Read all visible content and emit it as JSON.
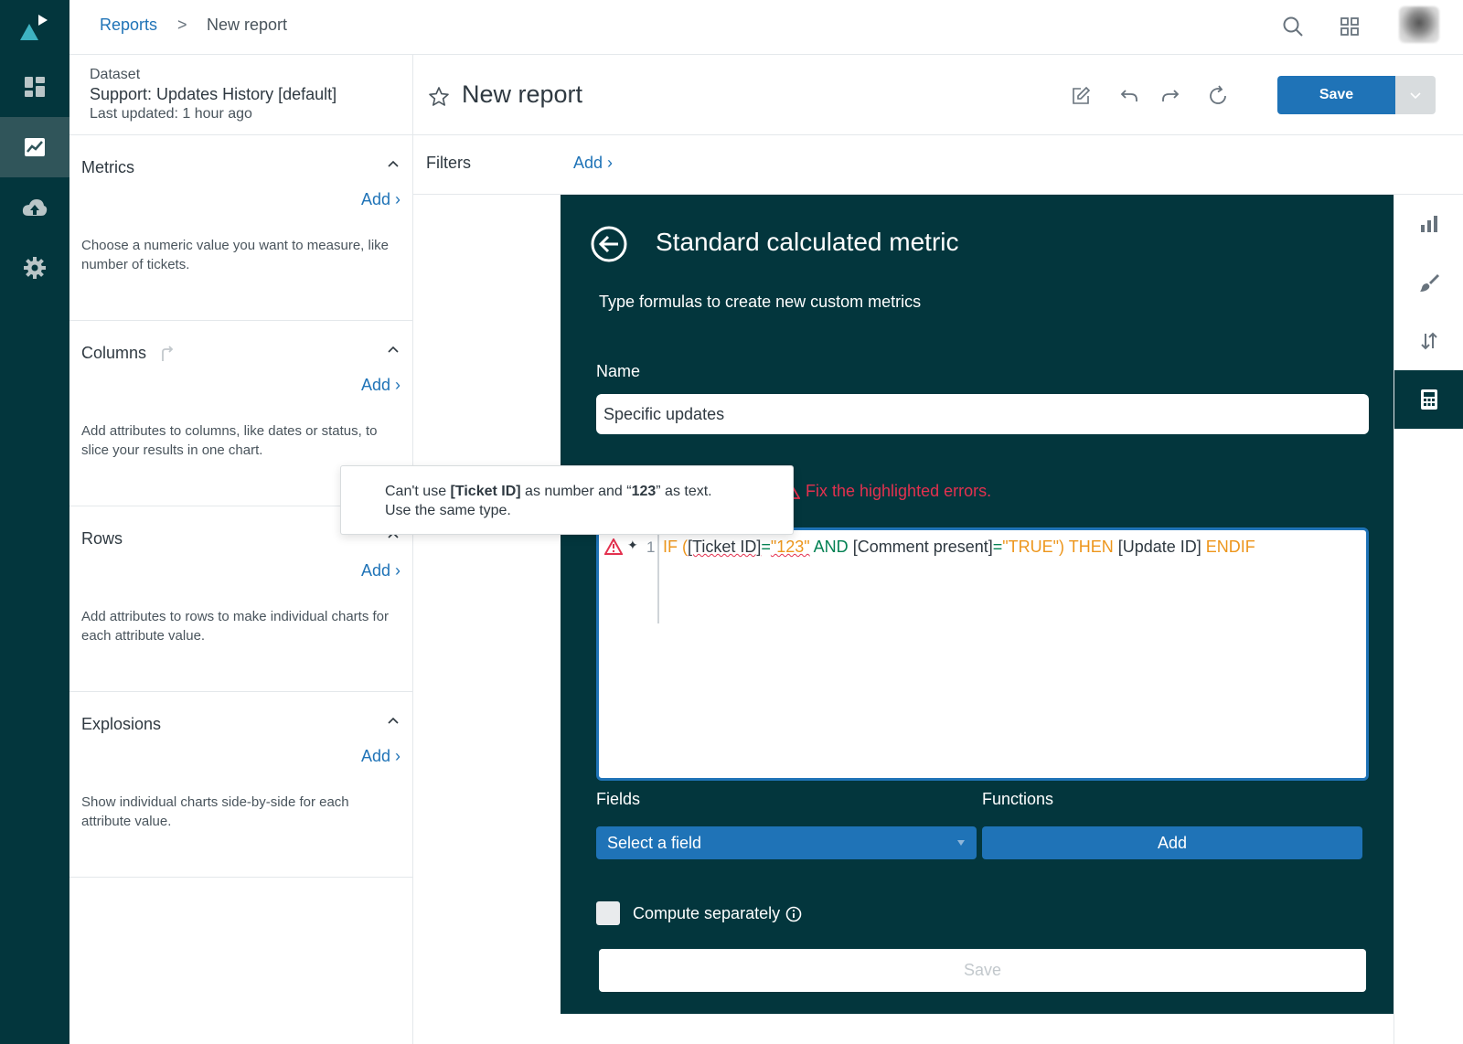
{
  "breadcrumb": {
    "parent": "Reports",
    "separator": ">",
    "current": "New report"
  },
  "dataset": {
    "label": "Dataset",
    "name": "Support: Updates History [default]",
    "updated": "Last updated: 1 hour ago"
  },
  "sections": [
    {
      "title": "Metrics",
      "add": "Add ›",
      "description": "Choose a numeric value you want to measure, like number of tickets."
    },
    {
      "title": "Columns",
      "add": "Add ›",
      "description": "Add attributes to columns, like dates or status, to slice your results in one chart."
    },
    {
      "title": "Rows",
      "add": "Add ›",
      "description": "Add attributes to rows to make individual charts for each attribute value."
    },
    {
      "title": "Explosions",
      "add": "Add ›",
      "description": "Show individual charts side-by-side for each attribute value."
    }
  ],
  "report": {
    "title": "New report",
    "save_label": "Save"
  },
  "filters": {
    "label": "Filters",
    "add": "Add ›"
  },
  "calc_metric": {
    "title": "Standard calculated metric",
    "subtitle": "Type formulas to create new custom metrics",
    "name_label": "Name",
    "name_value": "Specific updates",
    "error_message": "Fix the highlighted errors.",
    "line_number": "1",
    "formula_tokens": {
      "t1": "IF (",
      "t2": "[Ticket ID]",
      "t3": "=",
      "t4": "\"123\"",
      "t5": " AND ",
      "t6": "[Comment present]",
      "t7": "=",
      "t8": "\"TRUE\")",
      "t9": " THEN ",
      "t10": "[Update ID]",
      "t11": " ENDIF"
    },
    "fields_label": "Fields",
    "functions_label": "Functions",
    "field_select": "Select a field",
    "add_label": "Add",
    "compute_label": "Compute separately",
    "save_label": "Save"
  },
  "tooltip": {
    "p1": "Can't use ",
    "b1": "[Ticket ID]",
    "p2": " as number and “",
    "b2": "123",
    "p3": "” as text.",
    "line2": "Use the same type."
  },
  "colors": {
    "nav_bg": "#03363d",
    "primary": "#1f73b7",
    "error": "#e3314f",
    "keyword": "#ed961c",
    "operator": "#038153"
  }
}
